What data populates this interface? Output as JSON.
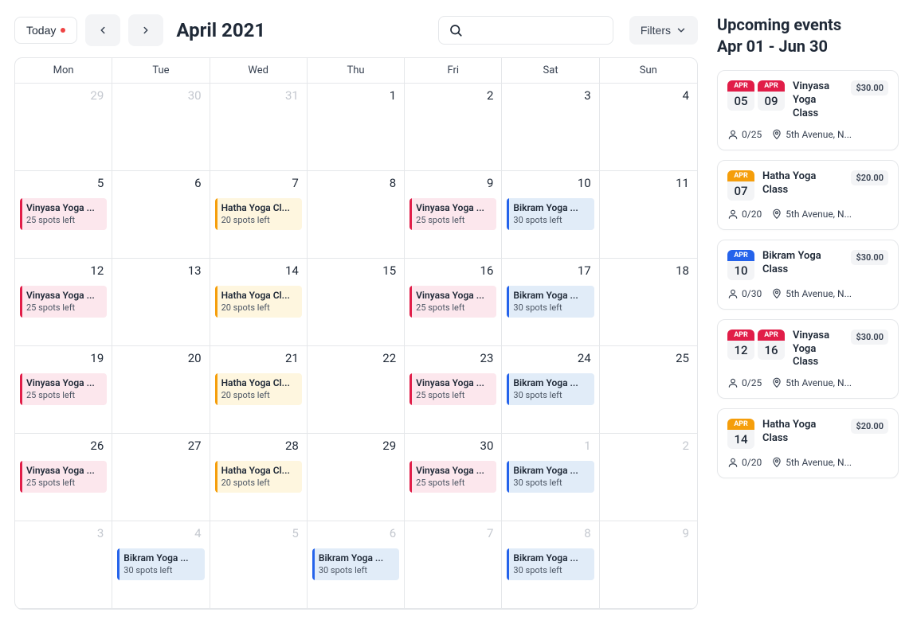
{
  "toolbar": {
    "today_label": "Today",
    "month_title": "April 2021",
    "filters_label": "Filters"
  },
  "dow": [
    "Mon",
    "Tue",
    "Wed",
    "Thu",
    "Fri",
    "Sat",
    "Sun"
  ],
  "weeks": [
    [
      {
        "num": "29",
        "muted": true
      },
      {
        "num": "30",
        "muted": true
      },
      {
        "num": "31",
        "muted": true
      },
      {
        "num": "1"
      },
      {
        "num": "2"
      },
      {
        "num": "3"
      },
      {
        "num": "4"
      }
    ],
    [
      {
        "num": "5",
        "ev": {
          "title": "Vinyasa Yoga ...",
          "sub": "25 spots left",
          "cls": "ev-pink"
        }
      },
      {
        "num": "6"
      },
      {
        "num": "7",
        "ev": {
          "title": "Hatha Yoga Cl...",
          "sub": "20 spots left",
          "cls": "ev-yellow"
        }
      },
      {
        "num": "8"
      },
      {
        "num": "9",
        "ev": {
          "title": "Vinyasa Yoga ...",
          "sub": "25 spots left",
          "cls": "ev-pink"
        }
      },
      {
        "num": "10",
        "ev": {
          "title": "Bikram Yoga ...",
          "sub": "30 spots left",
          "cls": "ev-blue"
        }
      },
      {
        "num": "11"
      }
    ],
    [
      {
        "num": "12",
        "ev": {
          "title": "Vinyasa Yoga ...",
          "sub": "25 spots left",
          "cls": "ev-pink"
        }
      },
      {
        "num": "13"
      },
      {
        "num": "14",
        "ev": {
          "title": "Hatha Yoga Cl...",
          "sub": "20 spots left",
          "cls": "ev-yellow"
        }
      },
      {
        "num": "15"
      },
      {
        "num": "16",
        "ev": {
          "title": "Vinyasa Yoga ...",
          "sub": "25 spots left",
          "cls": "ev-pink"
        }
      },
      {
        "num": "17",
        "ev": {
          "title": "Bikram Yoga ...",
          "sub": "30 spots left",
          "cls": "ev-blue"
        }
      },
      {
        "num": "18"
      }
    ],
    [
      {
        "num": "19",
        "ev": {
          "title": "Vinyasa Yoga ...",
          "sub": "25 spots left",
          "cls": "ev-pink"
        }
      },
      {
        "num": "20"
      },
      {
        "num": "21",
        "ev": {
          "title": "Hatha Yoga Cl...",
          "sub": "20 spots left",
          "cls": "ev-yellow"
        }
      },
      {
        "num": "22"
      },
      {
        "num": "23",
        "ev": {
          "title": "Vinyasa Yoga ...",
          "sub": "25 spots left",
          "cls": "ev-pink"
        }
      },
      {
        "num": "24",
        "ev": {
          "title": "Bikram Yoga ...",
          "sub": "30 spots left",
          "cls": "ev-blue"
        }
      },
      {
        "num": "25"
      }
    ],
    [
      {
        "num": "26",
        "ev": {
          "title": "Vinyasa Yoga ...",
          "sub": "25 spots left",
          "cls": "ev-pink"
        }
      },
      {
        "num": "27"
      },
      {
        "num": "28",
        "ev": {
          "title": "Hatha Yoga Cl...",
          "sub": "20 spots left",
          "cls": "ev-yellow"
        }
      },
      {
        "num": "29"
      },
      {
        "num": "30",
        "ev": {
          "title": "Vinyasa Yoga ...",
          "sub": "25 spots left",
          "cls": "ev-pink"
        }
      },
      {
        "num": "1",
        "muted": true,
        "ev": {
          "title": "Bikram Yoga ...",
          "sub": "30 spots left",
          "cls": "ev-blue"
        }
      },
      {
        "num": "2",
        "muted": true
      }
    ],
    [
      {
        "num": "3",
        "muted": true
      },
      {
        "num": "4",
        "muted": true,
        "ev": {
          "title": "Bikram Yoga ...",
          "sub": "30 spots left",
          "cls": "ev-blue"
        }
      },
      {
        "num": "5",
        "muted": true
      },
      {
        "num": "6",
        "muted": true,
        "ev": {
          "title": "Bikram Yoga ...",
          "sub": "30 spots left",
          "cls": "ev-blue"
        }
      },
      {
        "num": "7",
        "muted": true
      },
      {
        "num": "8",
        "muted": true,
        "ev": {
          "title": "Bikram Yoga ...",
          "sub": "30 spots left",
          "cls": "ev-blue"
        }
      },
      {
        "num": "9",
        "muted": true
      }
    ]
  ],
  "sidebar": {
    "title_line1": "Upcoming events",
    "title_line2": "Apr 01 - Jun 30",
    "cards": [
      {
        "dates": [
          {
            "m": "APR",
            "d": "05",
            "mc": "m-pink"
          },
          {
            "m": "APR",
            "d": "09",
            "mc": "m-pink"
          }
        ],
        "name": "Vinyasa Yoga Class",
        "price": "$30.00",
        "cap": "0/25",
        "loc": "5th Avenue, N..."
      },
      {
        "dates": [
          {
            "m": "APR",
            "d": "07",
            "mc": "m-yellow"
          }
        ],
        "name": "Hatha Yoga Class",
        "price": "$20.00",
        "cap": "0/20",
        "loc": "5th Avenue, N..."
      },
      {
        "dates": [
          {
            "m": "APR",
            "d": "10",
            "mc": "m-blue"
          }
        ],
        "name": "Bikram Yoga Class",
        "price": "$30.00",
        "cap": "0/30",
        "loc": "5th Avenue, N..."
      },
      {
        "dates": [
          {
            "m": "APR",
            "d": "12",
            "mc": "m-pink"
          },
          {
            "m": "APR",
            "d": "16",
            "mc": "m-pink"
          }
        ],
        "name": "Vinyasa Yoga Class",
        "price": "$30.00",
        "cap": "0/25",
        "loc": "5th Avenue, N..."
      },
      {
        "dates": [
          {
            "m": "APR",
            "d": "14",
            "mc": "m-yellow"
          }
        ],
        "name": "Hatha Yoga Class",
        "price": "$20.00",
        "cap": "0/20",
        "loc": "5th Avenue, N..."
      }
    ]
  }
}
